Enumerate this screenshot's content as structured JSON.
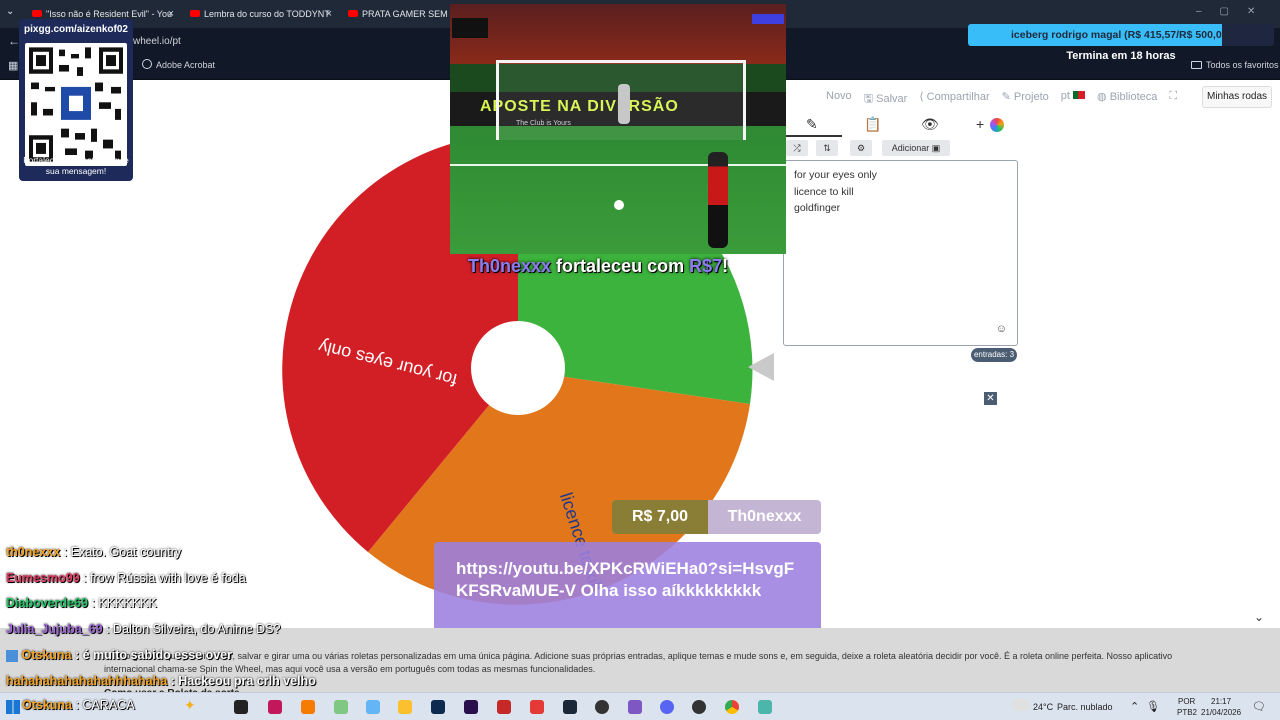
{
  "browser": {
    "tabs": [
      {
        "title": "\"Isso não é Resident Evil\" - You"
      },
      {
        "title": "Lembra do curso do TODDYNT"
      },
      {
        "title": "PRATA GAMER SEM LIM"
      }
    ],
    "url": "wheel.io/pt",
    "bookmarks": {
      "adobe": "Adobe Acrobat",
      "all": "Todos os favoritos"
    }
  },
  "wheel_app": {
    "menu": {
      "new": "Novo",
      "save": "Salvar",
      "share": "Compartilhar",
      "project": "Projeto",
      "language": "pt",
      "library": "Biblioteca",
      "my_wheels": "Minhas rodas"
    },
    "tools": {
      "add": "Adicionar"
    },
    "entries": [
      "for your eyes only",
      "licence to kill",
      "goldfinger"
    ],
    "entries_count": "entradas: 3",
    "wheel_labels": {
      "red": "for your eyes only",
      "orange": "licence to kill"
    },
    "colors": {
      "red": "#d21f26",
      "orange": "#e1761a",
      "green": "#3cb33c"
    },
    "footer_text": "…tório gratuito que permite criar, salvar e girar uma ou várias roletas personalizadas em uma única página. Adicione suas próprias entradas, aplique temas e mude sons e, em seguida, deixe a roleta aleatória decidir por você. É a roleta online perfeita. Nosso aplicativo internacional chama-se Spin the Wheel, mas aqui você usa a versão em português com todas as mesmas funcionalidades.",
    "footer_heading": "Como usar a Roleta da sorte"
  },
  "stream": {
    "qr": {
      "title": "pixgg.com/aizenkof02",
      "caption": "Fortaleça no donate e envie sua mensagem!"
    },
    "donation_notice": {
      "user": "Th0nexxx",
      "text": " fortaleceu com ",
      "amount": "R$7",
      "suffix": "!"
    },
    "goal": {
      "text": "iceberg rodrigo magal (R$ 415,57/R$ 500,00)",
      "progress": 0.83,
      "ends": "Termina em 18 horas"
    },
    "alert": {
      "amount": "R$ 7,00",
      "name": "Th0nexxx",
      "message": "https://youtu.be/XPKcRWiEHa0?si=HsvgFKFSRvaMUE-V Olha isso aíkkkkkkkkk"
    },
    "video": {
      "banner": "APOSTE NA DIVERSÃO",
      "ad": "The Club is Yours"
    },
    "chat": [
      {
        "user": "th0nexxx",
        "msg": ": Exato. Goat country",
        "color": "#f4a62a"
      },
      {
        "user": "Eumesmo99",
        "msg": ": frow Rússia with love é foda",
        "color": "#e03c63"
      },
      {
        "user": "Diaboverde69",
        "msg": ": KKKKKKK",
        "color": "#27c46a"
      },
      {
        "user": "Julia_Jujuba_69",
        "msg": ": Dalton Silveira, do Anime DS?",
        "color": "#9f6ad4"
      },
      {
        "user": "Otskuna",
        "msg": ": é muito sabido esse over",
        "color": "#f4a62a"
      },
      {
        "user": "hahahahahahahahhhahaha",
        "msg": ": Hackeou pra crlh velho",
        "color": "#f4a62a"
      },
      {
        "user": "Otskuna",
        "msg": ": CARACA",
        "color": "#f4a62a"
      }
    ]
  },
  "taskbar": {
    "weather": "24°C",
    "weather_desc": "Parc. nublado",
    "lang": "POR",
    "layout": "PTB2",
    "time": "21:17",
    "date": "21/04/2026"
  }
}
